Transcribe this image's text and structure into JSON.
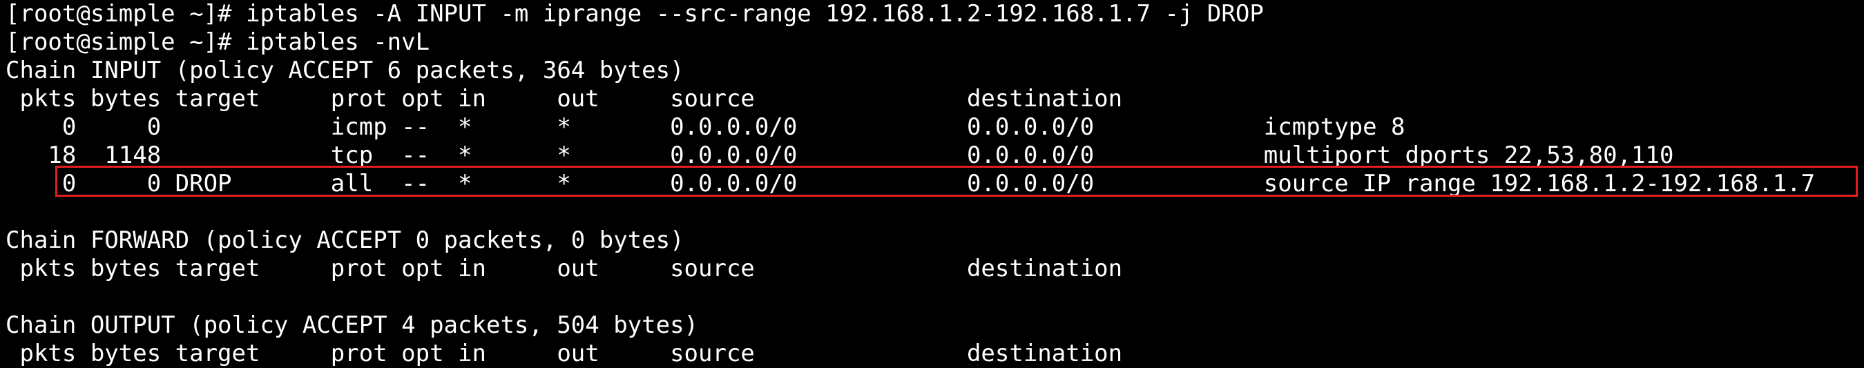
{
  "terminal": {
    "lines": [
      "[root@simple ~]# iptables -A INPUT -m iprange --src-range 192.168.1.2-192.168.1.7 -j DROP",
      "[root@simple ~]# iptables -nvL",
      "Chain INPUT (policy ACCEPT 6 packets, 364 bytes)",
      " pkts bytes target     prot opt in     out     source               destination",
      "    0     0            icmp --  *      *       0.0.0.0/0            0.0.0.0/0            icmptype 8",
      "   18  1148            tcp  --  *      *       0.0.0.0/0            0.0.0.0/0            multiport dports 22,53,80,110",
      "    0     0 DROP       all  --  *      *       0.0.0.0/0            0.0.0.0/0            source IP range 192.168.1.2-192.168.1.7",
      "",
      "Chain FORWARD (policy ACCEPT 0 packets, 0 bytes)",
      " pkts bytes target     prot opt in     out     source               destination",
      "",
      "Chain OUTPUT (policy ACCEPT 4 packets, 504 bytes)",
      " pkts bytes target     prot opt in     out     source               destination"
    ]
  },
  "annotation": {
    "highlight_color": "#e02020",
    "highlighted_line_index": 6
  }
}
